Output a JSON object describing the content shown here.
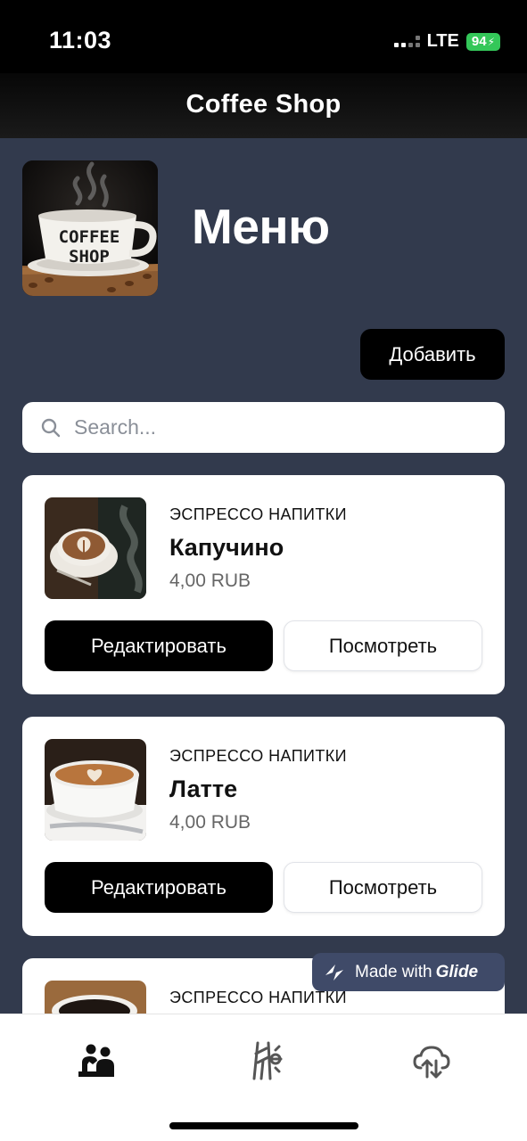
{
  "status_bar": {
    "time": "11:03",
    "network": "LTE",
    "battery": "94"
  },
  "header": {
    "title": "Coffee Shop"
  },
  "hero": {
    "image_label": "COFFEE SHOP",
    "label_line1": "COFFEE",
    "label_line2": "SHOP"
  },
  "page": {
    "title": "Меню"
  },
  "actions": {
    "add_label": "Добавить"
  },
  "search": {
    "placeholder": "Search...",
    "value": "",
    "icon": "search-icon"
  },
  "items": [
    {
      "category": "ЭСПРЕССО НАПИТКИ",
      "name": "Капучино",
      "price": "4,00 RUB",
      "edit_label": "Редактировать",
      "view_label": "Посмотреть"
    },
    {
      "category": "ЭСПРЕССО НАПИТКИ",
      "name": "Латте",
      "price": "4,00 RUB",
      "edit_label": "Редактировать",
      "view_label": "Посмотреть"
    },
    {
      "category": "ЭСПРЕССО НАПИТКИ"
    }
  ],
  "badge": {
    "prefix": "Made with",
    "brand": "Glide"
  },
  "tabs": [
    {
      "icon": "people-icon",
      "active": true
    },
    {
      "icon": "roads-icon",
      "active": false
    },
    {
      "icon": "cloud-sync-icon",
      "active": false
    }
  ],
  "colors": {
    "background": "#323a4d",
    "primary": "#000000",
    "card": "#ffffff",
    "badge": "#3f4a68",
    "battery": "#34c759"
  }
}
